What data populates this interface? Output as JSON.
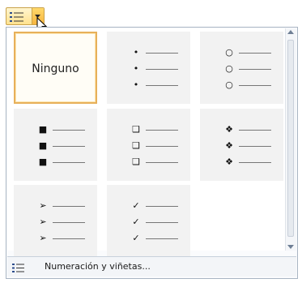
{
  "toolbar": {
    "button_icon": "bullet-list-icon",
    "dropdown_icon": "chevron-down-icon"
  },
  "gallery": {
    "none_label": "Ninguno",
    "bullet_sets": [
      {
        "symbol": "•"
      },
      {
        "symbol": "○"
      },
      {
        "symbol": "■"
      },
      {
        "symbol": "❑"
      },
      {
        "symbol": "❖"
      },
      {
        "symbol": "➢"
      },
      {
        "symbol": "✓"
      }
    ]
  },
  "footer": {
    "icon": "bullet-list-icon",
    "label": "Numeración y viñetas..."
  },
  "colors": {
    "selection_border": "#e7b05a",
    "cell_background": "#f2f2f2",
    "button_highlight": "#ffd86a"
  }
}
